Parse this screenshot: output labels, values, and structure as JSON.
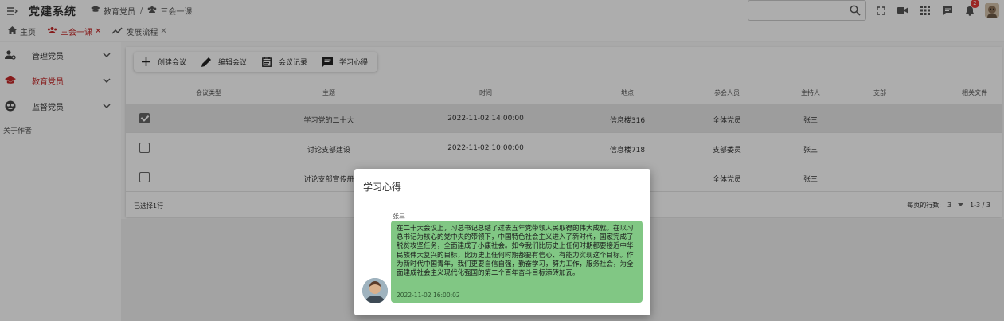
{
  "header": {
    "app_title": "党建系统",
    "breadcrumb": [
      "教育党员",
      "三会一课"
    ]
  },
  "tabs": [
    {
      "label": "主页",
      "active": false,
      "closable": false
    },
    {
      "label": "三会一课",
      "active": true,
      "closable": true
    },
    {
      "label": "发展流程",
      "active": false,
      "closable": true
    }
  ],
  "notifications": {
    "count": "2"
  },
  "sidebar": {
    "items": [
      {
        "label": "管理党员",
        "icon": "user-settings-icon"
      },
      {
        "label": "教育党员",
        "icon": "graduation-cap-icon",
        "active": true
      },
      {
        "label": "监督党员",
        "icon": "eye-icon"
      }
    ],
    "about": "关于作者"
  },
  "toolbar": {
    "create": "创建会议",
    "edit": "编辑会议",
    "records": "会议记录",
    "notes": "学习心得"
  },
  "table": {
    "columns": [
      "会议类型",
      "主题",
      "时间",
      "地点",
      "参会人员",
      "主持人",
      "支部",
      "相关文件"
    ],
    "rows": [
      {
        "selected": true,
        "type": "",
        "topic": "学习党的二十大",
        "time": "2022-11-02 14:00:00",
        "place": "信息楼316",
        "attendees": "全体党员",
        "host": "张三",
        "branch": "",
        "files": ""
      },
      {
        "selected": false,
        "type": "",
        "topic": "讨论支部建设",
        "time": "2022-11-02 10:00:00",
        "place": "信息楼718",
        "attendees": "支部委员",
        "host": "张三",
        "branch": "",
        "files": ""
      },
      {
        "selected": false,
        "type": "",
        "topic": "讨论支部宣传册",
        "time": "",
        "place": "",
        "attendees": "全体党员",
        "host": "张三",
        "branch": "",
        "files": ""
      }
    ],
    "footer": {
      "selected_text": "已选择1行",
      "rows_per_page_label": "每页的行数:",
      "rows_per_page": "3",
      "range": "1-3 / 3"
    }
  },
  "dialog": {
    "title": "学习心得",
    "author": "张三",
    "message": "在二十大会议上，习总书记总结了过去五年党带领人民取得的伟大成就。在以习总书记为核心的党中央的带领下，中国特色社会主义进入了新时代，国家完成了脱贫攻坚任务，全面建成了小康社会。如今我们比历史上任何时期都要接近中华民族伟大复兴的目标，比历史上任何时期都要有信心、有能力实现这个目标。作为新时代中国青年，我们更要自信自强，勤奋学习，努力工作，服务社会，为全面建成社会主义现代化强国的第二个百年奋斗目标添砖加瓦。",
    "time": "2022-11-02 16:00:02",
    "bubble_color": "#81c784"
  },
  "colors": {
    "accent": "#c62828"
  }
}
